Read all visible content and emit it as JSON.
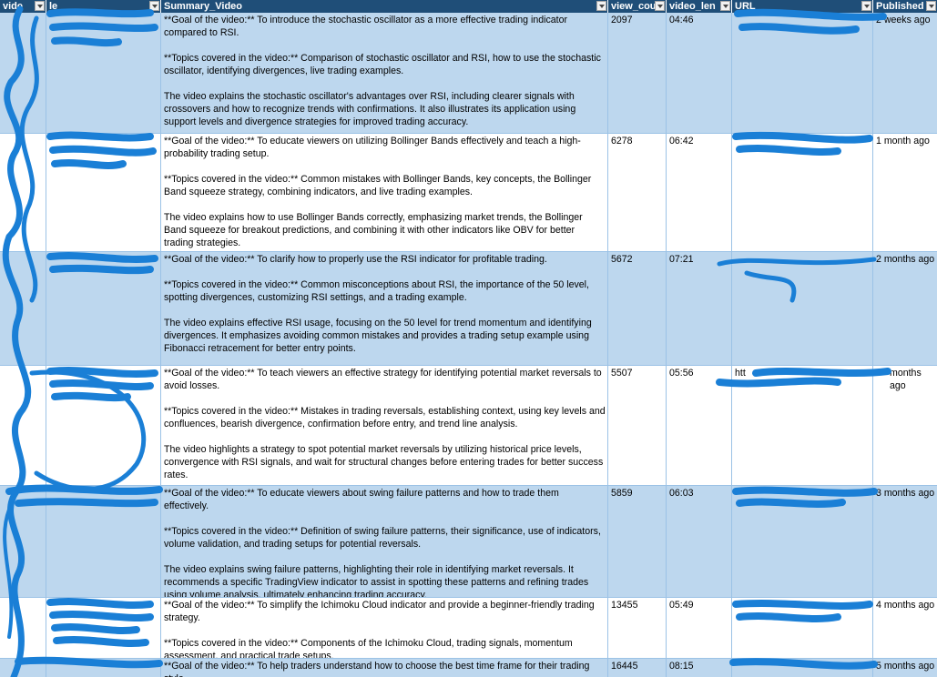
{
  "headers": {
    "video_id": "vide",
    "title": "le",
    "summary": "Summary_Video",
    "views": "view_cou",
    "length": "video_len",
    "url": "URL",
    "published": "Published"
  },
  "rows": [
    {
      "views": "2097",
      "length": "04:46",
      "published": "2 weeks ago",
      "goal": "**Goal of the video:** To introduce the stochastic oscillator as a more effective trading indicator compared to RSI.",
      "topics": "**Topics covered in the video:** Comparison of stochastic oscillator and RSI, how to use the stochastic oscillator, identifying divergences, live trading examples.",
      "explain": "The video explains the stochastic oscillator's advantages over RSI, including clearer signals with crossovers and how to recognize trends with confirmations. It also illustrates its application using support levels and divergence strategies for improved trading accuracy."
    },
    {
      "views": "6278",
      "length": "06:42",
      "published": "1 month ago",
      "goal": "**Goal of the video:** To educate viewers on utilizing Bollinger Bands effectively and teach a high-probability trading setup.",
      "topics": "**Topics covered in the video:** Common mistakes with Bollinger Bands, key concepts, the Bollinger Band squeeze strategy, combining indicators, and live trading examples.",
      "explain": "The video explains how to use Bollinger Bands correctly, emphasizing market trends, the Bollinger Band squeeze for breakout predictions, and combining it with other indicators like OBV for better trading strategies."
    },
    {
      "views": "5672",
      "length": "07:21",
      "published": "2 months ago",
      "goal": "**Goal of the video:** To clarify how to properly use the RSI indicator for profitable trading.",
      "topics": "**Topics covered in the video:** Common misconceptions about RSI, the importance of the 50 level, spotting divergences, customizing RSI settings, and a trading example.",
      "explain": "The video explains effective RSI usage, focusing on the 50 level for trend momentum and identifying divergences. It emphasizes avoiding common mistakes and provides a trading setup example using Fibonacci retracement for better entry points."
    },
    {
      "views": "5507",
      "length": "05:56",
      "published": "months ago",
      "url": "htt",
      "goal": "**Goal of the video:** To teach viewers an effective strategy for identifying potential market reversals to avoid losses.",
      "topics": "**Topics covered in the video:** Mistakes in trading reversals, establishing context, using key levels and confluences, bearish divergence, confirmation before entry, and trend line analysis.",
      "explain": "The video highlights a strategy to spot potential market reversals by utilizing historical price levels, convergence with RSI signals, and wait for structural changes before entering trades for better success rates."
    },
    {
      "views": "5859",
      "length": "06:03",
      "published": "3 months ago",
      "goal": "**Goal of the video:** To educate viewers about swing failure patterns and how to trade them effectively.",
      "topics": "**Topics covered in the video:** Definition of swing failure patterns, their significance, use of indicators, volume validation, and trading setups for potential reversals.",
      "explain": "The video explains swing failure patterns, highlighting their role in identifying market reversals. It recommends a specific TradingView indicator to assist in spotting these patterns and refining trades using volume analysis, ultimately enhancing trading accuracy."
    },
    {
      "views": "13455",
      "length": "05:49",
      "published": "4 months ago",
      "goal": "**Goal of the video:** To simplify the Ichimoku Cloud indicator and provide a beginner-friendly trading strategy.",
      "topics": "**Topics covered in the video:** Components of the Ichimoku Cloud, trading signals, momentum assessment, and practical trade setups.",
      "explain": ""
    },
    {
      "views": "16445",
      "length": "08:15",
      "published": "5 months ago",
      "goal": "**Goal of the video:** To help traders understand how to choose the best time frame for their trading style.",
      "topics": "",
      "explain": ""
    }
  ]
}
